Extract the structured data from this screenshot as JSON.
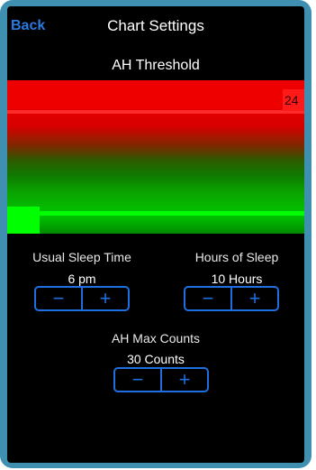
{
  "nav": {
    "back_label": "Back",
    "title": "Chart Settings"
  },
  "threshold": {
    "title": "AH Threshold",
    "value": "24"
  },
  "sleep_time": {
    "label": "Usual Sleep Time",
    "value": "6 pm",
    "minus": "−",
    "plus": "+"
  },
  "hours_sleep": {
    "label": "Hours of Sleep",
    "value": "10 Hours",
    "minus": "−",
    "plus": "+"
  },
  "max_counts": {
    "label": "AH Max Counts",
    "value": "30 Counts",
    "minus": "−",
    "plus": "+"
  },
  "colors": {
    "accent": "#1f6fe0",
    "frame": "#3f8fb0",
    "red": "#ee0000",
    "green": "#00ff00"
  }
}
